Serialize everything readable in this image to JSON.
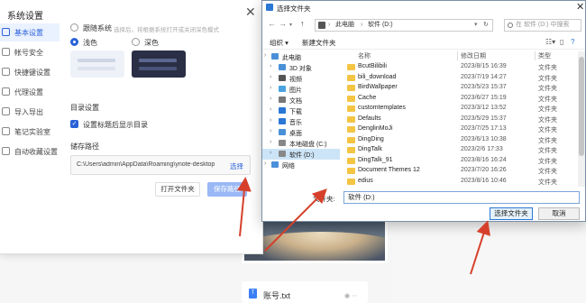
{
  "note": {
    "title": "账号.txt"
  },
  "settings": {
    "title": "系统设置",
    "sidebar": [
      {
        "label": "基本设置",
        "active": true
      },
      {
        "label": "帐号安全",
        "active": false
      },
      {
        "label": "快捷键设置",
        "active": false
      },
      {
        "label": "代理设置",
        "active": false
      },
      {
        "label": "导入导出",
        "active": false
      },
      {
        "label": "笔记实验室",
        "active": false
      },
      {
        "label": "自动收藏设置",
        "active": false
      }
    ],
    "follow_system": "跟随系统",
    "follow_hint": "选择后，将根据系统打开或关闭深色模式",
    "light": "浅色",
    "dark": "深色",
    "dir_section": "目录设置",
    "dir_checkbox": "设置标题后显示目录",
    "storage_section": "储存路径",
    "storage_path": "C:\\Users\\admin\\AppData\\Roaming\\ynote-desktop",
    "pick": "选择",
    "open_folder": "打开文件夹",
    "save_path": "保存路径"
  },
  "file_dialog": {
    "title": "选择文件夹",
    "address": [
      "此电脑",
      "软件 (D:)"
    ],
    "search_placeholder": "在 软件 (D:) 中搜索",
    "organize": "组织 ▾",
    "new_folder": "新建文件夹",
    "nav": [
      {
        "label": "此电脑",
        "indent": 0,
        "color": "#4a90d9",
        "selected": false
      },
      {
        "label": "3D 对象",
        "indent": 1,
        "color": "#4a90d9",
        "selected": false
      },
      {
        "label": "视频",
        "indent": 1,
        "color": "#555555",
        "selected": false
      },
      {
        "label": "图片",
        "indent": 1,
        "color": "#4aa3df",
        "selected": false
      },
      {
        "label": "文档",
        "indent": 1,
        "color": "#777777",
        "selected": false
      },
      {
        "label": "下载",
        "indent": 1,
        "color": "#2a77d6",
        "selected": false
      },
      {
        "label": "音乐",
        "indent": 1,
        "color": "#2a77d6",
        "selected": false
      },
      {
        "label": "桌面",
        "indent": 1,
        "color": "#4a90d9",
        "selected": false
      },
      {
        "label": "本地磁盘 (C:)",
        "indent": 1,
        "color": "#888888",
        "selected": false
      },
      {
        "label": "软件 (D:)",
        "indent": 1,
        "color": "#888888",
        "selected": true
      },
      {
        "label": "网络",
        "indent": 0,
        "color": "#4a90d9",
        "selected": false
      }
    ],
    "columns": {
      "name": "名称",
      "date": "修改日期",
      "type": "类型"
    },
    "files": [
      {
        "name": "BcutBilibili",
        "date": "2023/8/15 16:39",
        "type": "文件夹"
      },
      {
        "name": "bili_download",
        "date": "2023/7/19 14:27",
        "type": "文件夹"
      },
      {
        "name": "BirdWallpaper",
        "date": "2023/5/23 15:37",
        "type": "文件夹"
      },
      {
        "name": "Cache",
        "date": "2023/6/27 15:19",
        "type": "文件夹"
      },
      {
        "name": "customtemplates",
        "date": "2023/3/12 13:52",
        "type": "文件夹"
      },
      {
        "name": "Defaults",
        "date": "2023/5/29 15:37",
        "type": "文件夹"
      },
      {
        "name": "DenglinMoJi",
        "date": "2023/7/25 17:13",
        "type": "文件夹"
      },
      {
        "name": "DingDing",
        "date": "2023/6/13 10:38",
        "type": "文件夹"
      },
      {
        "name": "DingTalk",
        "date": "2023/2/6 17:33",
        "type": "文件夹"
      },
      {
        "name": "DingTalk_91",
        "date": "2023/8/16 16:24",
        "type": "文件夹"
      },
      {
        "name": "Document Themes 12",
        "date": "2023/7/20 16:26",
        "type": "文件夹"
      },
      {
        "name": "edius",
        "date": "2023/8/16 10:46",
        "type": "文件夹"
      }
    ],
    "folder_label": "文件夹:",
    "folder_value": "软件 (D:)",
    "select_button": "选择文件夹",
    "cancel_button": "取消"
  }
}
